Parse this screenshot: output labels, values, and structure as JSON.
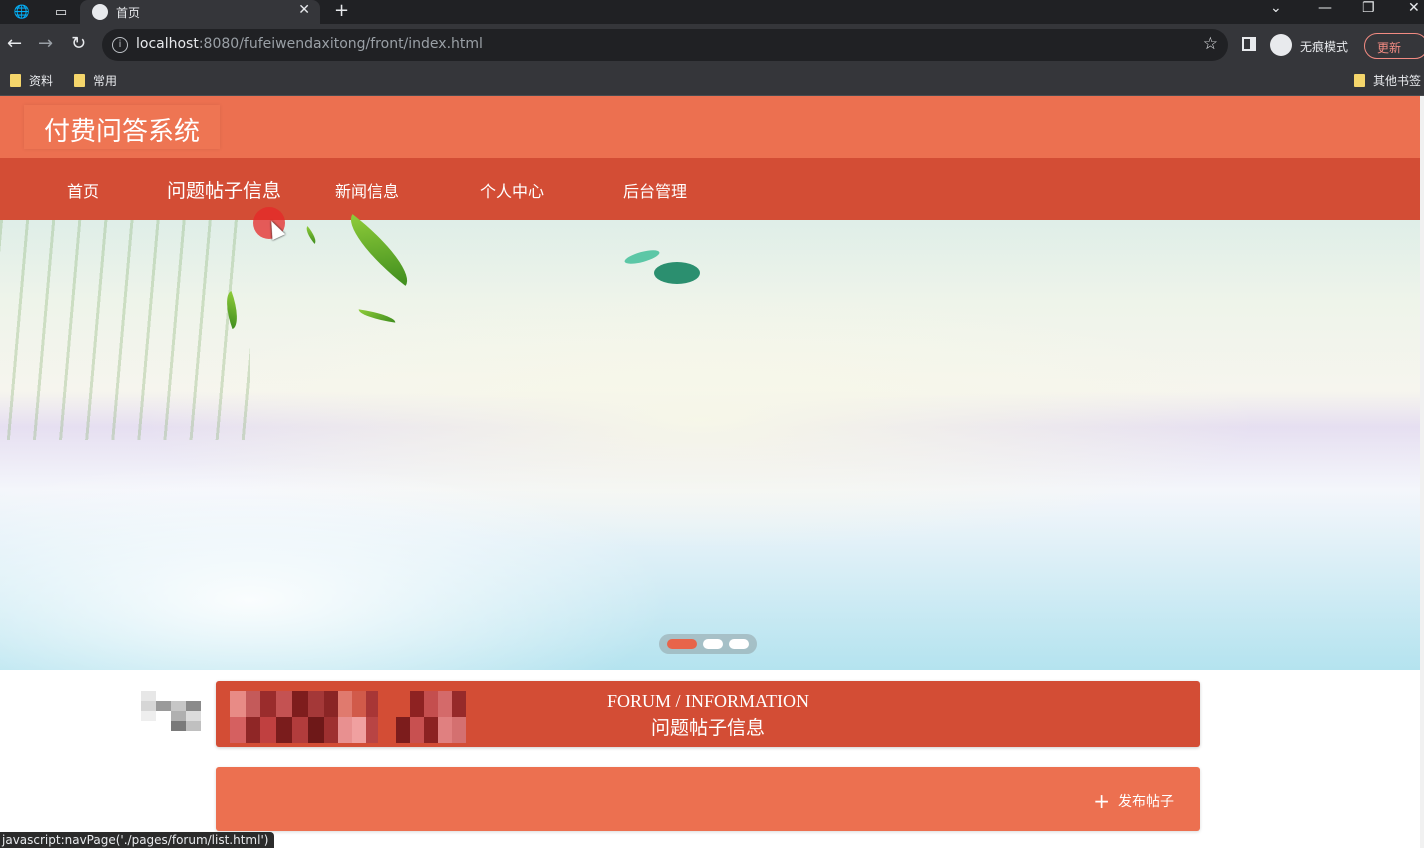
{
  "browser": {
    "tab_title": "首页",
    "address_host": "localhost",
    "address_rest": ":8080/fufeiwendaxitong/front/index.html",
    "incognito_label": "无痕模式",
    "update_label": "更新",
    "bookmarks": [
      "资料",
      "常用"
    ],
    "other_bookmarks": "其他书签"
  },
  "site": {
    "logo": "付费问答系统",
    "nav": [
      {
        "label": "首页"
      },
      {
        "label": "问题帖子信息"
      },
      {
        "label": "新闻信息"
      },
      {
        "label": "个人中心"
      },
      {
        "label": "后台管理"
      }
    ]
  },
  "carousel": {
    "slide_count": 3,
    "active_index": 0
  },
  "section": {
    "title_en": "FORUM / INFORMATION",
    "title_cn": "问题帖子信息",
    "publish_label": "发布帖子"
  },
  "status_bar": "javascript:navPage('./pages/forum/list.html')",
  "colors": {
    "header": "#ec7050",
    "nav": "#d34d35",
    "accent": "#e8644a"
  }
}
